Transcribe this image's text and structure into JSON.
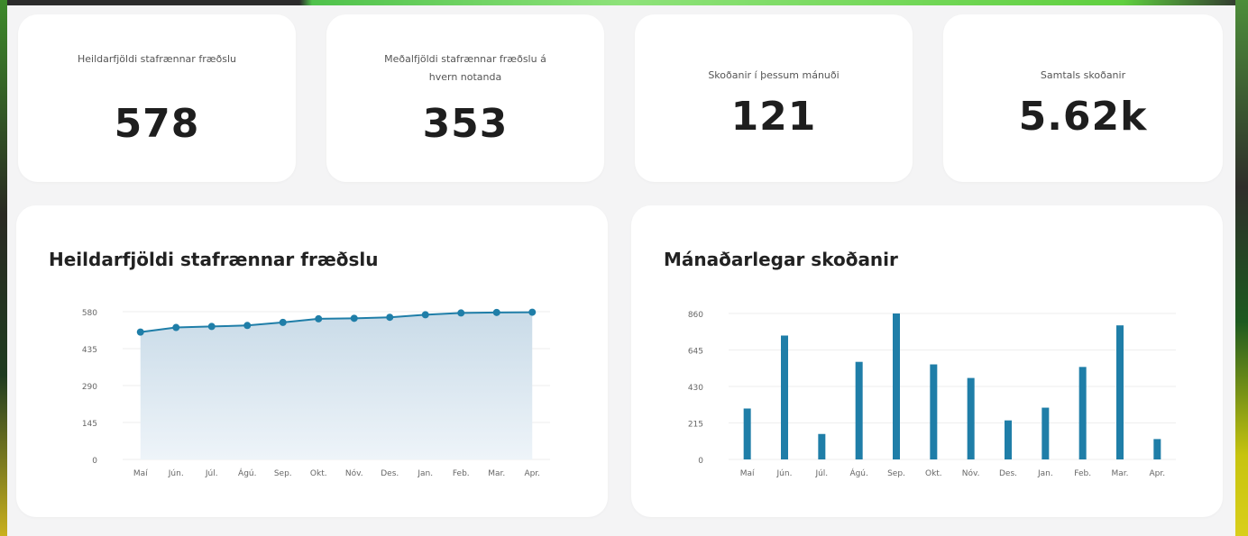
{
  "stats": [
    {
      "label": "Heildarfjöldi stafrænnar fræðslu",
      "value": "578"
    },
    {
      "label": "Meðalfjöldi stafrænnar fræðslu á hvern notanda",
      "value": "353"
    },
    {
      "label": "Skoðanir í þessum mánuði",
      "value": "121"
    },
    {
      "label": "Samtals skoðanir",
      "value": "5.62k"
    }
  ],
  "colors": {
    "accent": "#1f7ea8",
    "area_top": "#c9dbe8",
    "area_bottom": "#eef4f9"
  },
  "charts": {
    "line_title": "Heildarfjöldi stafrænnar fræðslu",
    "bar_title": "Mánaðarlegar skoðanir"
  },
  "chart_data": [
    {
      "type": "area",
      "title": "Heildarfjöldi stafrænnar fræðslu",
      "categories": [
        "Maí",
        "Jún.",
        "Júl.",
        "Ágú.",
        "Sep.",
        "Okt.",
        "Nóv.",
        "Des.",
        "Jan.",
        "Feb.",
        "Mar.",
        "Apr."
      ],
      "values": [
        500,
        518,
        522,
        526,
        538,
        552,
        554,
        558,
        568,
        575,
        577,
        578
      ],
      "yticks": [
        0,
        145,
        290,
        435,
        580
      ],
      "ylim": [
        0,
        580
      ],
      "grid": true
    },
    {
      "type": "bar",
      "title": "Mánaðarlegar skoðanir",
      "categories": [
        "Maí",
        "Jún.",
        "Júl.",
        "Ágú.",
        "Sep.",
        "Okt.",
        "Nóv.",
        "Des.",
        "Jan.",
        "Feb.",
        "Mar.",
        "Apr."
      ],
      "values": [
        300,
        730,
        150,
        575,
        860,
        560,
        480,
        230,
        305,
        545,
        790,
        120
      ],
      "yticks": [
        0,
        215,
        430,
        645,
        860
      ],
      "ylim": [
        0,
        860
      ],
      "grid": true
    }
  ]
}
